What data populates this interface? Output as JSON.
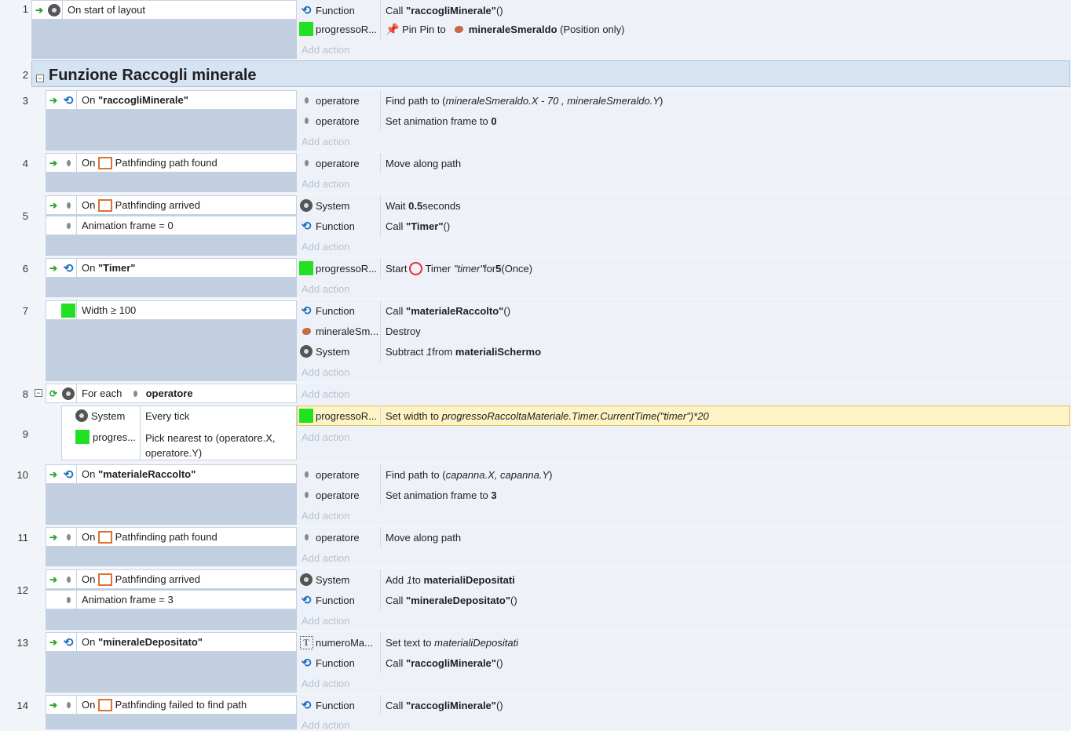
{
  "rows": [
    {
      "n": "1",
      "cond": "On start of layout",
      "actions": [
        {
          "obj": "Function",
          "text_pre": "Call ",
          "b1": "\"raccogliMinerale\"",
          "text_post": " ()"
        },
        {
          "obj": "progressoR...",
          "pin_label": "Pin Pin to",
          "target": "mineraleSmeraldo",
          "target_post": "(Position only)"
        }
      ]
    },
    {
      "n": "2",
      "group_title": "Funzione Raccogli minerale"
    },
    {
      "n": "3",
      "cond_pre": "On ",
      "cond_b": "\"raccogliMinerale\"",
      "actions": [
        {
          "obj": "operatore",
          "text_pre": "Find path to (",
          "i1": "mineraleSmeraldo.X - 70 , mineraleSmeraldo.Y",
          "text_post": ")"
        },
        {
          "obj": "operatore",
          "text_pre": "Set animation frame to ",
          "b1": "0"
        }
      ]
    },
    {
      "n": "4",
      "cond": "On",
      "cond_post": "Pathfinding path found",
      "actions": [
        {
          "obj": "operatore",
          "text_pre": "Move along path"
        }
      ]
    },
    {
      "n": "5",
      "cond": "On",
      "cond_post": "Pathfinding arrived",
      "cond2": "Animation frame = 0",
      "actions": [
        {
          "obj": "System",
          "text_pre": "Wait ",
          "b1": "0.5",
          "text_post": " seconds"
        },
        {
          "obj": "Function",
          "text_pre": "Call ",
          "b1": "\"Timer\"",
          "text_post": " ()"
        }
      ]
    },
    {
      "n": "6",
      "cond_pre": "On ",
      "cond_b": "\"Timer\"",
      "actions": [
        {
          "obj": "progressoR...",
          "text_pre": "Start ",
          "timer_label": "Timer",
          "i1": "\"timer\"",
          "mid": " for ",
          "b1": "5",
          "text_post": " (Once)"
        }
      ]
    },
    {
      "n": "7",
      "cond": "Width ≥ 100",
      "actions": [
        {
          "obj": "Function",
          "text_pre": "Call ",
          "b1": "\"materialeRaccolto\"",
          "text_post": " ()"
        },
        {
          "obj": "mineraleSm...",
          "text_pre": "Destroy"
        },
        {
          "obj": "System",
          "text_pre": "Subtract ",
          "i1": "1",
          "mid": " from ",
          "b1": "materialiSchermo"
        }
      ]
    },
    {
      "n": "8",
      "foreach_label": "For each",
      "foreach_obj": "operatore"
    },
    {
      "n": "9",
      "sub_obj1": "System",
      "sub_cond1": "Every tick",
      "sub_obj2": "progres...",
      "sub_cond2": "Pick nearest to (operatore.X, operatore.Y)",
      "actions": [
        {
          "obj": "progressoR...",
          "text_pre": "Set width to ",
          "i1": "progressoRaccoltaMateriale.Timer.CurrentTime(\"timer\")*20"
        }
      ]
    },
    {
      "n": "10",
      "cond_pre": "On ",
      "cond_b": "\"materialeRaccolto\"",
      "actions": [
        {
          "obj": "operatore",
          "text_pre": "Find path to (",
          "i1": "capanna.X, capanna.Y",
          "text_post": ")"
        },
        {
          "obj": "operatore",
          "text_pre": "Set animation frame to ",
          "b1": "3"
        }
      ]
    },
    {
      "n": "11",
      "cond": "On",
      "cond_post": "Pathfinding path found",
      "actions": [
        {
          "obj": "operatore",
          "text_pre": "Move along path"
        }
      ]
    },
    {
      "n": "12",
      "cond": "On",
      "cond_post": "Pathfinding arrived",
      "cond2": "Animation frame = 3",
      "actions": [
        {
          "obj": "System",
          "text_pre": "Add ",
          "i1": "1",
          "mid": " to ",
          "b1": "materialiDepositati"
        },
        {
          "obj": "Function",
          "text_pre": "Call ",
          "b1": "\"mineraleDepositato\"",
          "text_post": " ()"
        }
      ]
    },
    {
      "n": "13",
      "cond_pre": "On ",
      "cond_b": "\"mineraleDepositato\"",
      "actions": [
        {
          "obj": "numeroMa...",
          "text_pre": "Set text to ",
          "i1": "materialiDepositati"
        },
        {
          "obj": "Function",
          "text_pre": "Call ",
          "b1": "\"raccogliMinerale\"",
          "text_post": " ()"
        }
      ]
    },
    {
      "n": "14",
      "cond": "On",
      "cond_post": "Pathfinding failed to find path",
      "actions": [
        {
          "obj": "Function",
          "text_pre": "Call ",
          "b1": "\"raccogliMinerale\"",
          "text_post": " ()"
        }
      ]
    }
  ],
  "add_action_label": "Add action",
  "colors": {
    "highlight": "#fdf4c5",
    "accent_green": "#22e022",
    "condition_bg": "#c2cfe0"
  }
}
